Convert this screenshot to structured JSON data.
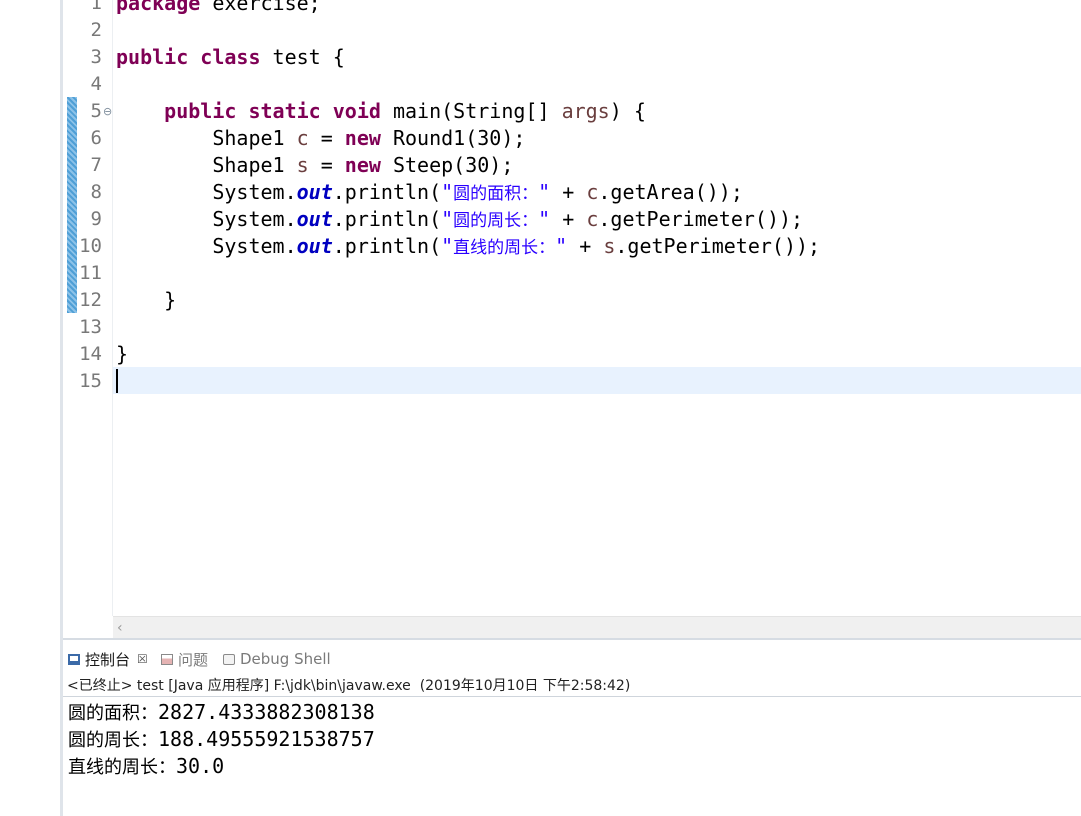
{
  "editor": {
    "line_numbers": [
      "1",
      "2",
      "3",
      "4",
      "5",
      "6",
      "7",
      "8",
      "9",
      "10",
      "11",
      "12",
      "13",
      "14",
      "15"
    ],
    "line1": {
      "kw": "package",
      "rest": " exercise;"
    },
    "line3": {
      "kw1": "public",
      "kw2": "class",
      "rest": " test {"
    },
    "line5": {
      "indent": "    ",
      "kw1": "public",
      "kw2": "static",
      "kw3": "void",
      "mid": " main(String[] ",
      "var": "args",
      "end": ") {"
    },
    "line6": {
      "indent": "        ",
      "a": "Shape1 ",
      "var": "c",
      "b": " = ",
      "kw": "new",
      "c": " Round1(30);"
    },
    "line7": {
      "indent": "        ",
      "a": "Shape1 ",
      "var": "s",
      "b": " = ",
      "kw": "new",
      "c": " Steep(30);"
    },
    "line8": {
      "indent": "        ",
      "a": "System.",
      "fld": "out",
      "b": ".println(",
      "q1": "\"",
      "cjk": "圆的面积：",
      "q2": "\"",
      "c": " + ",
      "var": "c",
      "d": ".getArea());"
    },
    "line9": {
      "indent": "        ",
      "a": "System.",
      "fld": "out",
      "b": ".println(",
      "q1": "\"",
      "cjk": "圆的周长：",
      "q2": "\"",
      "c": " + ",
      "var": "c",
      "d": ".getPerimeter());"
    },
    "line10": {
      "indent": "        ",
      "a": "System.",
      "fld": "out",
      "b": ".println(",
      "q1": "\"",
      "cjk": "直线的周长：",
      "q2": "\"",
      "c": " + ",
      "var": "s",
      "d": ".getPerimeter());"
    },
    "line12": {
      "text": "    }"
    },
    "line14": {
      "text": "}"
    }
  },
  "console": {
    "tabs": [
      {
        "label": "控制台",
        "icon": "console-icon",
        "close": "☒"
      },
      {
        "label": "问题",
        "icon": "problems-icon"
      },
      {
        "label": "Debug Shell",
        "icon": "debug-shell-icon"
      }
    ],
    "status": "<已终止> test [Java 应用程序] F:\\jdk\\bin\\javaw.exe  (2019年10月10日 下午2:58:42)",
    "output": [
      {
        "label": "圆的面积：",
        "value": "2827.4333882308138"
      },
      {
        "label": "圆的周长：",
        "value": "188.49555921538757"
      },
      {
        "label": "直线的周长：",
        "value": "30.0"
      }
    ]
  },
  "colors": {
    "keyword": "#7f0055",
    "string": "#2a00ff",
    "static_field": "#0000c0",
    "local_var": "#6a3e3e",
    "current_line": "#e8f2fe"
  }
}
